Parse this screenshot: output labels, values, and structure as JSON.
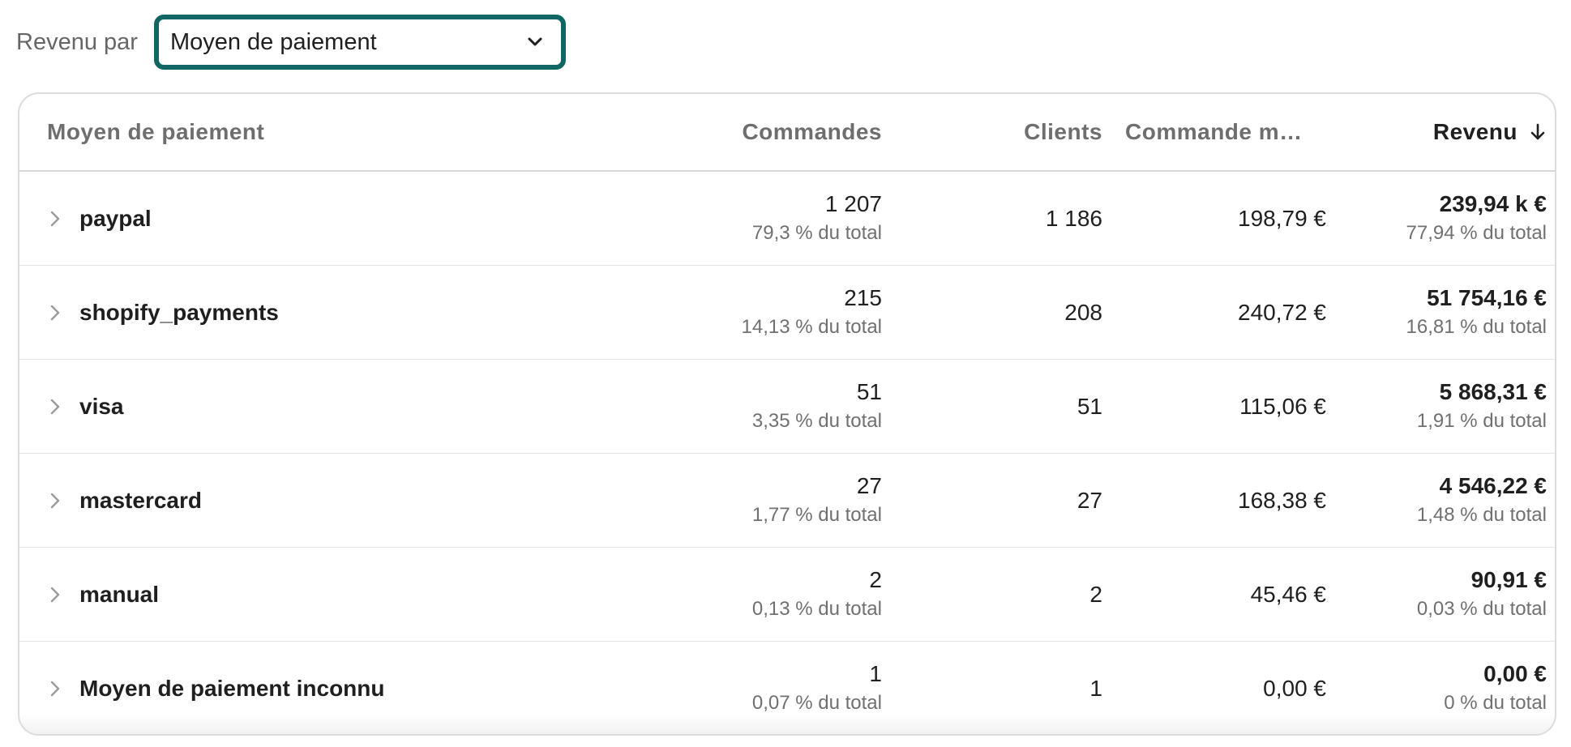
{
  "toolbar": {
    "label": "Revenu par",
    "select_value": "Moyen de paiement"
  },
  "table": {
    "headers": {
      "name": "Moyen de paiement",
      "orders": "Commandes",
      "clients": "Clients",
      "avg": "Commande m…",
      "revenue": "Revenu"
    },
    "sort": {
      "column": "revenue",
      "direction": "descending",
      "icon": "arrow-down-icon"
    },
    "rows": [
      {
        "name": "paypal",
        "orders": "1 207",
        "orders_share": "79,3 % du total",
        "clients": "1 186",
        "avg": "198,79 €",
        "revenue": "239,94 k €",
        "revenue_share": "77,94 % du total"
      },
      {
        "name": "shopify_payments",
        "orders": "215",
        "orders_share": "14,13 % du total",
        "clients": "208",
        "avg": "240,72 €",
        "revenue": "51 754,16 €",
        "revenue_share": "16,81 % du total"
      },
      {
        "name": "visa",
        "orders": "51",
        "orders_share": "3,35 % du total",
        "clients": "51",
        "avg": "115,06 €",
        "revenue": "5 868,31 €",
        "revenue_share": "1,91 % du total"
      },
      {
        "name": "mastercard",
        "orders": "27",
        "orders_share": "1,77 % du total",
        "clients": "27",
        "avg": "168,38 €",
        "revenue": "4 546,22 €",
        "revenue_share": "1,48 % du total"
      },
      {
        "name": "manual",
        "orders": "2",
        "orders_share": "0,13 % du total",
        "clients": "2",
        "avg": "45,46 €",
        "revenue": "90,91 €",
        "revenue_share": "0,03 % du total"
      },
      {
        "name": "Moyen de paiement inconnu",
        "orders": "1",
        "orders_share": "0,07 % du total",
        "clients": "1",
        "avg": "0,00 €",
        "revenue": "0,00 €",
        "revenue_share": "0 % du total"
      }
    ]
  },
  "colors": {
    "accent": "#0f6662",
    "text": "#1f1f1f",
    "muted": "#707070",
    "border": "#dcdcdc"
  }
}
